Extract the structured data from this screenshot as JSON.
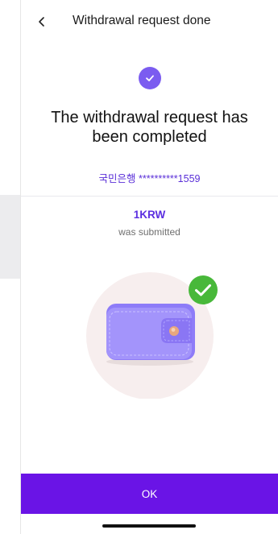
{
  "header": {
    "back_icon": "chevron-left-icon",
    "title": "Withdrawal request done"
  },
  "status": {
    "icon": "check-icon",
    "color": "#7b5cf0"
  },
  "message": {
    "line1": "The withdrawal request has",
    "line2": "been completed"
  },
  "account": {
    "bank_name": "국민은행",
    "masked_number": "**********1559"
  },
  "amount": {
    "value": "1KRW",
    "caption": "was submitted"
  },
  "illustration": {
    "subject": "wallet-illustration",
    "badge_icon": "green-check-icon"
  },
  "actions": {
    "ok_label": "OK",
    "ok_color": "#6a14e6"
  },
  "theme": {
    "accent": "#5b2ee0"
  }
}
